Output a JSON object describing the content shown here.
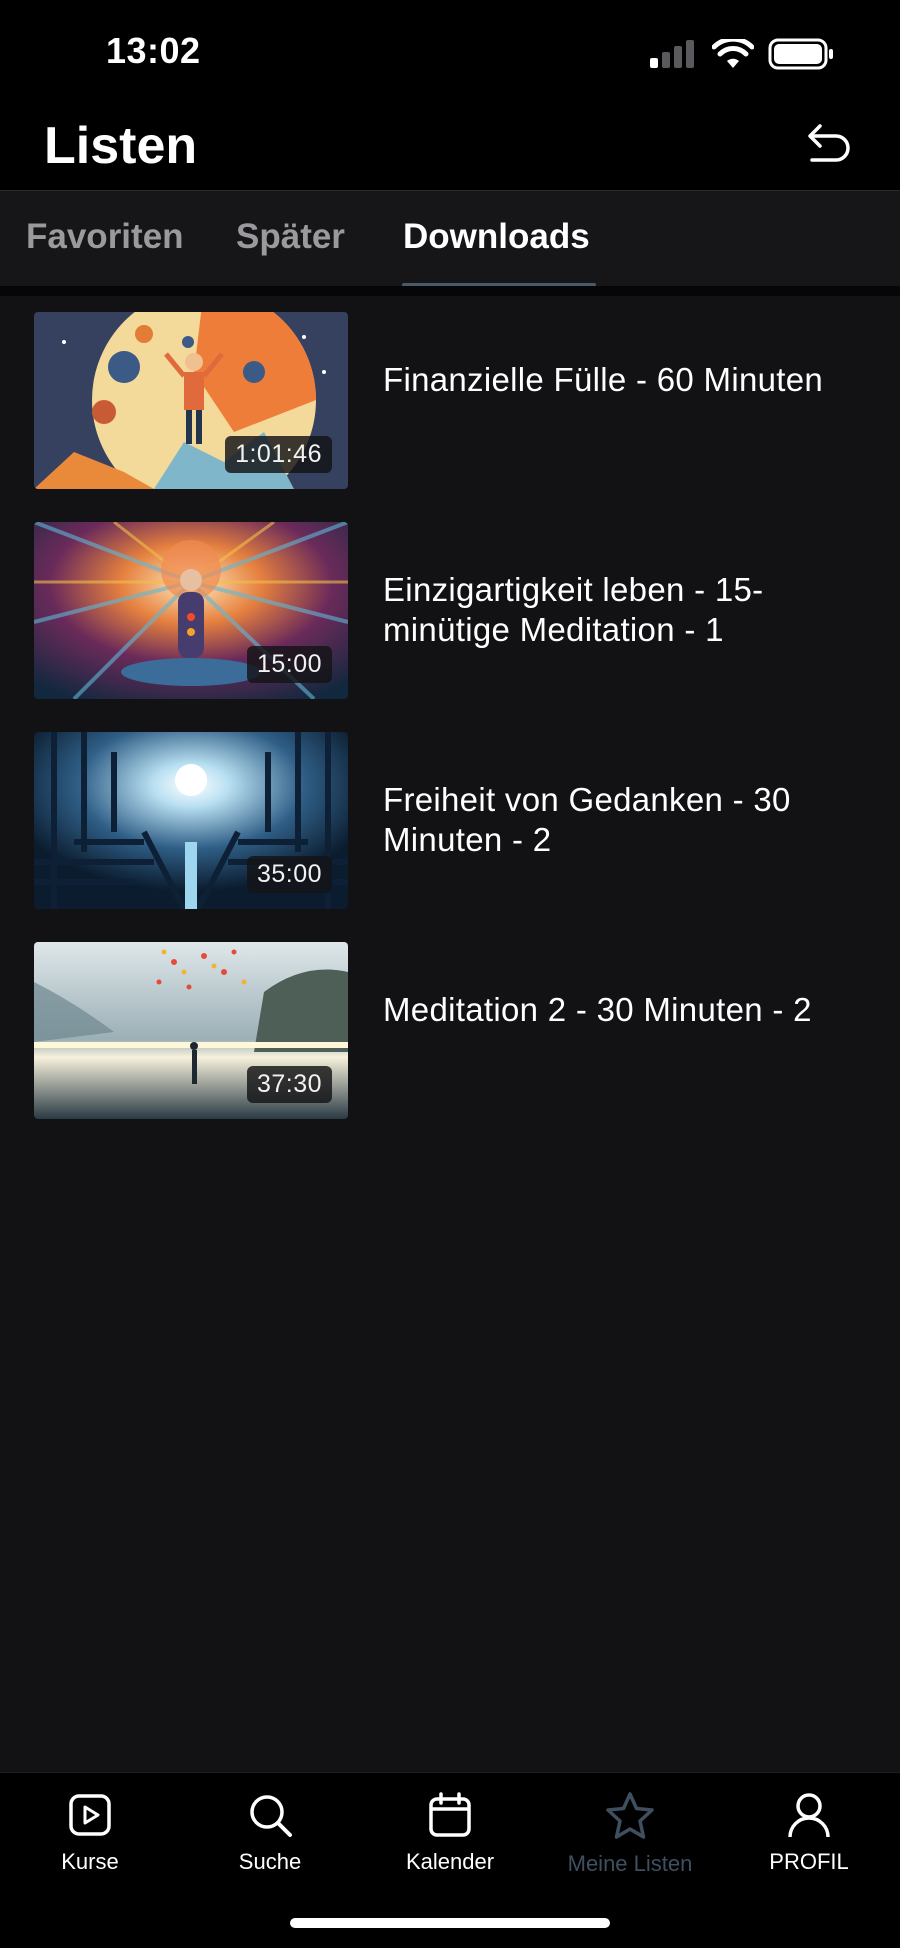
{
  "status": {
    "time": "13:02"
  },
  "header": {
    "title": "Listen",
    "back_icon": "back-arrow-icon"
  },
  "tabs": [
    {
      "label": "Favoriten",
      "active": false
    },
    {
      "label": "Später",
      "active": false
    },
    {
      "label": "Downloads",
      "active": true
    }
  ],
  "items": [
    {
      "title": "Finanzielle Fülle - 60 Minuten",
      "duration": "1:01:46"
    },
    {
      "title": "Einzigartigkeit leben - 15-minütige Meditation - 1",
      "duration": "15:00"
    },
    {
      "title": "Freiheit von Gedanken - 30 Minuten - 2",
      "duration": "35:00"
    },
    {
      "title": "Meditation 2 - 30 Minuten - 2",
      "duration": "37:30"
    }
  ],
  "nav": [
    {
      "label": "Kurse",
      "icon": "play-square-icon",
      "active": false
    },
    {
      "label": "Suche",
      "icon": "search-icon",
      "active": false
    },
    {
      "label": "Kalender",
      "icon": "calendar-icon",
      "active": false
    },
    {
      "label": "Meine Listen",
      "icon": "star-icon",
      "active": true
    },
    {
      "label": "PROFIL",
      "icon": "user-icon",
      "active": false
    }
  ],
  "colors": {
    "background": "#121214",
    "active_nav": "#3f4f5f",
    "tab_underline": "#4a5a6a"
  }
}
